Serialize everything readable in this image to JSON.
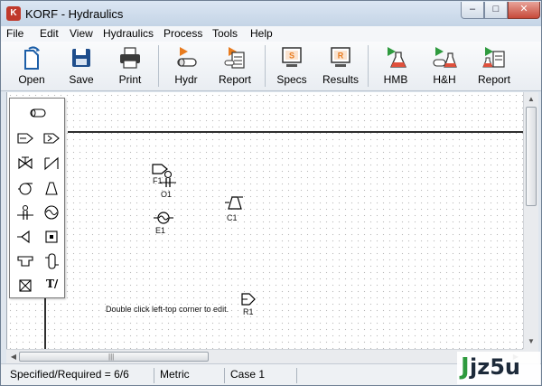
{
  "window": {
    "title": "KORF - Hydraulics",
    "app_icon_letter": "K"
  },
  "window_buttons": {
    "minimize": "–",
    "maximize": "□",
    "close": "✕"
  },
  "menu": {
    "items": [
      "File",
      "Edit",
      "View",
      "Hydraulics",
      "Process",
      "Tools",
      "Help"
    ]
  },
  "toolbar": {
    "buttons": [
      {
        "label": "Open",
        "icon": "open-file-icon"
      },
      {
        "label": "Save",
        "icon": "save-disk-icon"
      },
      {
        "label": "Print",
        "icon": "printer-icon"
      },
      {
        "label": "Hydr",
        "icon": "hydraulics-run-icon"
      },
      {
        "label": "Report",
        "icon": "report-icon"
      },
      {
        "label": "Specs",
        "icon": "specs-monitor-icon"
      },
      {
        "label": "Results",
        "icon": "results-monitor-icon"
      },
      {
        "label": "HMB",
        "icon": "flask-run-icon"
      },
      {
        "label": "H&H",
        "icon": "flask-pipe-icon"
      },
      {
        "label": "Report",
        "icon": "flask-report-icon"
      }
    ],
    "spec_letter": "S",
    "result_letter": "R"
  },
  "palette": {
    "text_tool_label": "T/",
    "items": [
      "pipe",
      "feed-source",
      "product-sink",
      "valve",
      "check-valve",
      "pump",
      "compressor",
      "orifice",
      "exchanger",
      "nozzle",
      "vessel",
      "tee",
      "column",
      "misc",
      "text"
    ]
  },
  "diagram": {
    "equipment": [
      {
        "label": "F1"
      },
      {
        "label": "O1"
      },
      {
        "label": "C1"
      },
      {
        "label": "E1"
      },
      {
        "label": "R1"
      }
    ],
    "hint": "Double click left-top corner to edit."
  },
  "status": {
    "specified": "Specified/Required = 6/6",
    "units": "Metric",
    "case": "Case 1"
  },
  "watermark": {
    "j": "J",
    "text": "jz5u"
  },
  "scrollbars": {
    "up": "▲",
    "down": "▼",
    "left": "◀",
    "right": "▶",
    "grip": "|||"
  }
}
